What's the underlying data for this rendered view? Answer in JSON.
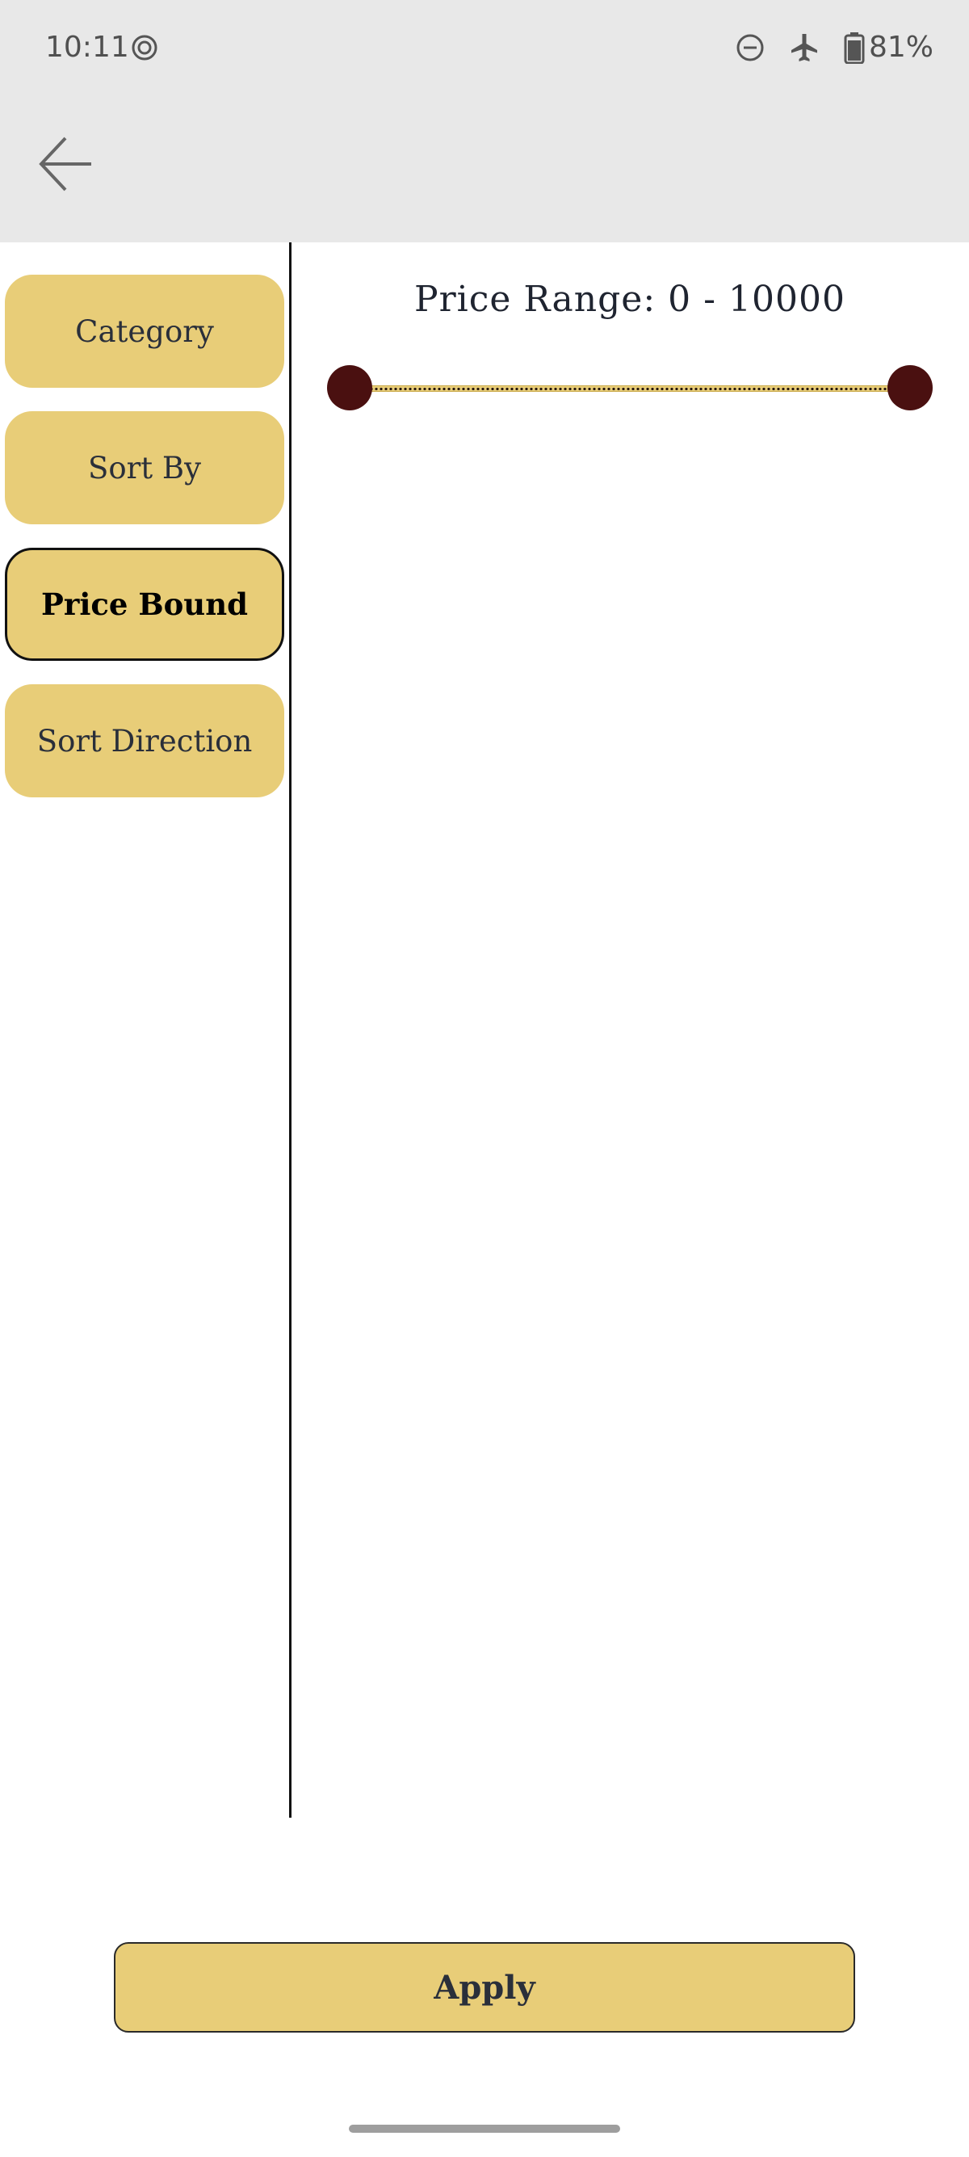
{
  "status_bar": {
    "time": "10:11",
    "battery": "81%",
    "icons": [
      "sync-icon",
      "do-not-disturb-icon",
      "airplane-mode-icon",
      "battery-icon"
    ]
  },
  "app_bar": {
    "back_icon": "arrow-left-icon"
  },
  "sidebar": {
    "items": [
      {
        "label": "Category",
        "active": false
      },
      {
        "label": "Sort By",
        "active": false
      },
      {
        "label": "Price Bound",
        "active": true
      },
      {
        "label": "Sort Direction",
        "active": false
      }
    ]
  },
  "price_filter": {
    "label": "Price Range: 0 - 10000",
    "min": 0,
    "max": 10000,
    "selected_low": 0,
    "selected_high": 10000
  },
  "footer": {
    "apply_label": "Apply"
  },
  "colors": {
    "accent": "#e8cd78",
    "thumb": "#4a1010",
    "background": "#ffffff",
    "top_bar": "#e8e8e8"
  }
}
